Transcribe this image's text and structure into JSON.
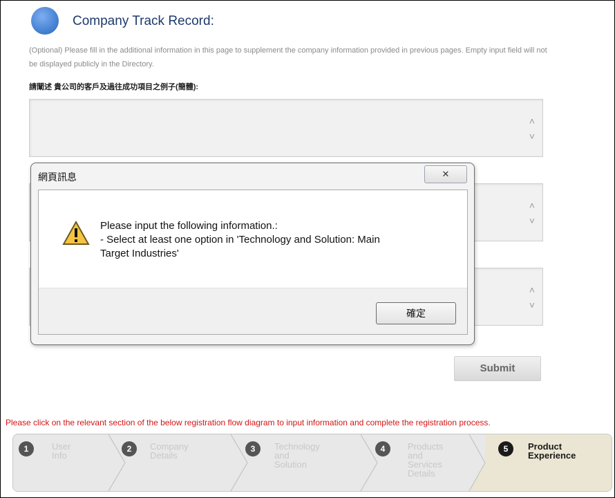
{
  "section": {
    "icon": "blue-circle-icon",
    "title": "Company Track Record:",
    "help_text": "(Optional) Please fill in the additional information in this page to supplement the company information provided in previous pages. Empty input field will not be displayed publicly in the Directory.",
    "field1_label": "請闡述 貴公司的客戶及過往成功項目之例子(簡體):"
  },
  "fields": [
    {
      "value": ""
    },
    {
      "value": ""
    },
    {
      "value": ""
    }
  ],
  "submit_label": "Submit",
  "instruction": "Please click on the relevant section of the below registration flow diagram to input information and complete the registration process.",
  "flow": {
    "steps": [
      {
        "number": "1",
        "label_lines": [
          "User",
          "Info"
        ],
        "active": false
      },
      {
        "number": "2",
        "label_lines": [
          "Company",
          "Details"
        ],
        "active": false
      },
      {
        "number": "3",
        "label_lines": [
          "Technology",
          "and",
          "Solution"
        ],
        "active": false
      },
      {
        "number": "4",
        "label_lines": [
          "Products",
          "and",
          "Services",
          "Details"
        ],
        "active": false
      },
      {
        "number": "5",
        "label_lines": [
          "Product",
          "Experience"
        ],
        "active": true
      }
    ]
  },
  "dialog": {
    "title": "網頁訊息",
    "close_icon": "close-icon",
    "warning_icon": "warning-icon",
    "message_lines": [
      "Please input the following information.:",
      "- Select at least one option in 'Technology and Solution: Main",
      "Target Industries'"
    ],
    "ok_label": "確定"
  },
  "colors": {
    "title": "#1e3a6d",
    "instruction": "#d21414",
    "active_step_bg": "#ebe6d3"
  }
}
